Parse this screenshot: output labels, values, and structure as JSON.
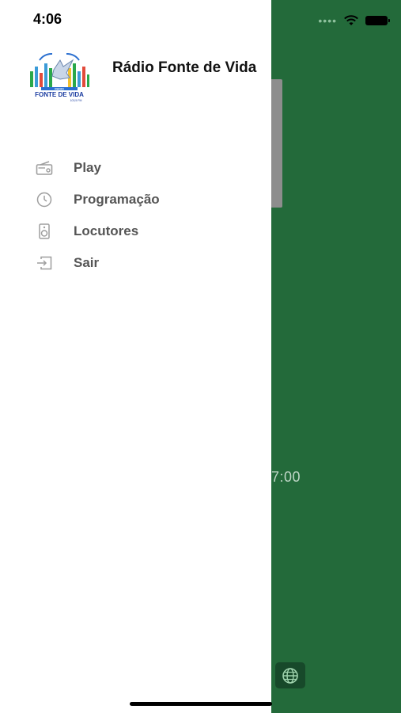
{
  "status_bar": {
    "time": "4:06"
  },
  "drawer": {
    "app_title": "Rádio Fonte de Vida",
    "logo_text": "RADIO FONTE DE VIDA 103,5 FM",
    "menu": [
      {
        "label": "Play",
        "icon": "radio-icon"
      },
      {
        "label": "Programação",
        "icon": "clock-icon"
      },
      {
        "label": "Locutores",
        "icon": "speaker-icon"
      },
      {
        "label": "Sair",
        "icon": "logout-icon"
      }
    ]
  },
  "background": {
    "time_fragment": "7:00",
    "globe_icon": "globe-icon"
  },
  "colors": {
    "background_green": "#236a3a",
    "menu_text": "#555555",
    "icon_gray": "#9e9e9e"
  }
}
